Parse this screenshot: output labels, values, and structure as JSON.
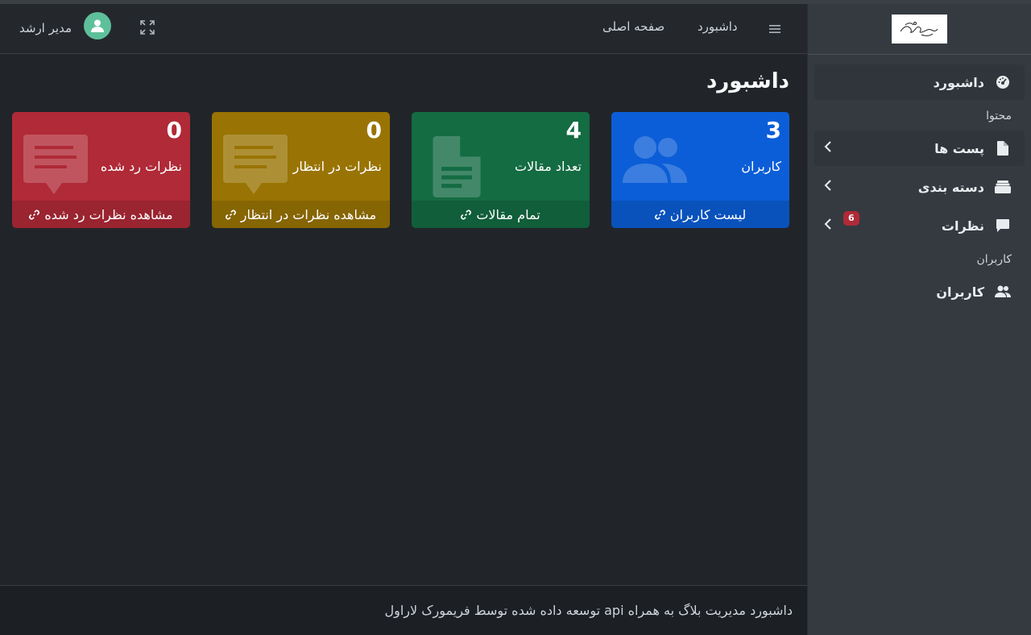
{
  "brand": {
    "logo_alt": "logo"
  },
  "sidebar": {
    "items": [
      {
        "label": "داشبورد",
        "icon": "gauge-icon",
        "active": true
      },
      {
        "header": "محتوا"
      },
      {
        "label": "پست ها",
        "icon": "file-icon"
      },
      {
        "label": "دسته بندی",
        "icon": "layers-icon"
      },
      {
        "label": "نظرات",
        "icon": "comment-icon",
        "badge": "6"
      },
      {
        "header": "کاربران"
      },
      {
        "label": "کاربران",
        "icon": "users-icon"
      }
    ]
  },
  "navbar": {
    "menu_icon": "hamburger-icon",
    "links": [
      "داشبورد",
      "صفحه اصلی"
    ],
    "fullscreen_icon": "expand-icon",
    "user_name": "مدیر ارشد"
  },
  "page": {
    "title": "داشبورد"
  },
  "cards": [
    {
      "count": "3",
      "caption": "کاربران",
      "footer": "لیست کاربران",
      "color": "#0b5ed7",
      "icon": "users-icon"
    },
    {
      "count": "4",
      "caption": "تعداد مقالات",
      "footer": "تمام مقالات",
      "color": "#146c43",
      "icon": "file-icon"
    },
    {
      "count": "0",
      "caption": "نظرات در انتظار",
      "footer": "مشاهده نظرات در انتظار",
      "color": "#997404",
      "icon": "comment-icon"
    },
    {
      "count": "0",
      "caption": "نظرات رد شده",
      "footer": "مشاهده نظرات رد شده",
      "color": "#b02a37",
      "icon": "comment-icon"
    }
  ],
  "footer": {
    "text": "داشبورد مدیریت بلاگ به همراه api توسعه داده شده توسط فریمورک لاراول"
  }
}
